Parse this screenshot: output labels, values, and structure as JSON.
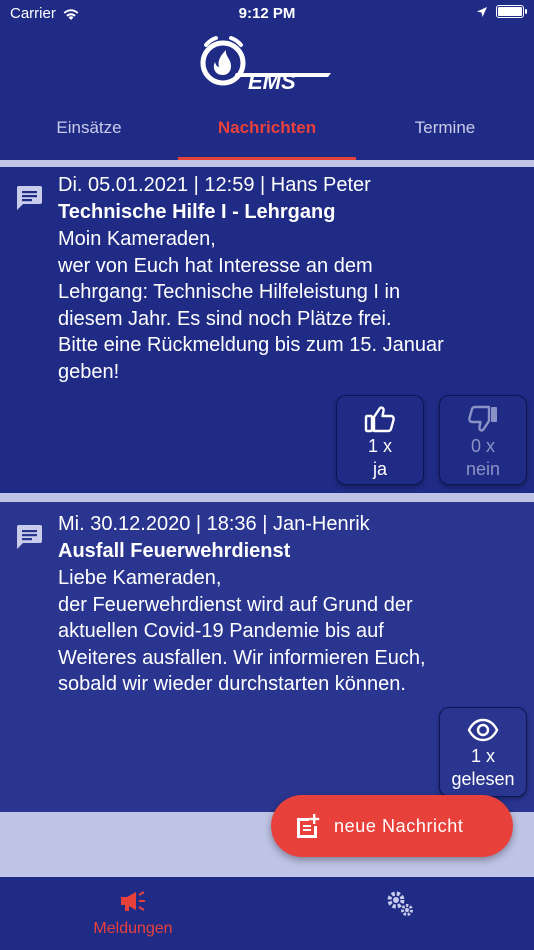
{
  "status_bar": {
    "carrier": "Carrier",
    "time": "9:12 PM"
  },
  "header": {
    "logo_text": "EMS"
  },
  "tabs": [
    {
      "label": "Einsätze",
      "active": false
    },
    {
      "label": "Nachrichten",
      "active": true
    },
    {
      "label": "Termine",
      "active": false
    }
  ],
  "messages": [
    {
      "meta": "Di. 05.01.2021 | 12:59 | Hans Peter",
      "title": "Technische Hilfe I - Lehrgang",
      "body_lines": [
        "Moin Kameraden,",
        "wer von Euch hat Interesse an dem",
        "Lehrgang: Technische Hilfeleistung I in",
        "diesem Jahr. Es sind noch Plätze frei.",
        "Bitte eine Rückmeldung bis zum 15. Januar",
        "geben!"
      ],
      "actions": [
        {
          "count": "1 x",
          "label": "ja",
          "icon": "thumbs-up-icon"
        },
        {
          "count": "0 x",
          "label": "nein",
          "icon": "thumbs-down-icon"
        }
      ]
    },
    {
      "meta": "Mi. 30.12.2020 | 18:36 | Jan-Henrik",
      "title": "Ausfall Feuerwehrdienst",
      "body_lines": [
        "Liebe Kameraden,",
        "der Feuerwehrdienst wird auf Grund der",
        "aktuellen Covid-19 Pandemie bis auf",
        "Weiteres ausfallen. Wir informieren Euch,",
        "sobald wir wieder durchstarten können."
      ],
      "actions": [
        {
          "count": "1 x",
          "label": "gelesen",
          "icon": "eye-icon"
        }
      ]
    }
  ],
  "fab": {
    "label": "neue Nachricht",
    "icon": "new-note-icon"
  },
  "bottom_nav": [
    {
      "label": "Meldungen",
      "icon": "megaphone-icon",
      "active": true
    },
    {
      "label": "",
      "icon": "gears-icon",
      "active": false
    }
  ],
  "colors": {
    "primary": "#1f2b85",
    "accent": "#e8413c",
    "background": "#bfc4e6",
    "muted": "#8b92c6"
  }
}
